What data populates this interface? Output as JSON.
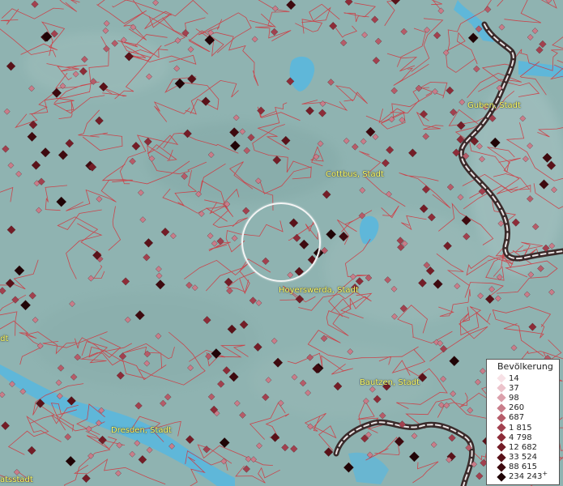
{
  "map": {
    "colors": {
      "terrain": "#8fb3b1",
      "water": "#5fb7d9",
      "borders": "#d3333b",
      "national_border": "#3a2a2a"
    }
  },
  "cities": [
    {
      "name": "Guben, Stadt"
    },
    {
      "name": "Cottbus, Stadt"
    },
    {
      "name": "Hoyerswerda, Stadt"
    },
    {
      "name": "Bautzen, Stadt"
    },
    {
      "name": "Dresden, Stadt"
    },
    {
      "name": "atsstadt"
    },
    {
      "name": "adt"
    }
  ],
  "legend": {
    "title": "Bevölkerung",
    "items": [
      {
        "label": "14",
        "color": "#f7e1e6"
      },
      {
        "label": "37",
        "color": "#ecc3cb"
      },
      {
        "label": "98",
        "color": "#dba0ab"
      },
      {
        "label": "260",
        "color": "#c97d8a"
      },
      {
        "label": "687",
        "color": "#b65c69"
      },
      {
        "label": "1 815",
        "color": "#a2414f"
      },
      {
        "label": "4 798",
        "color": "#8d2c38"
      },
      {
        "label": "12 682",
        "color": "#741d27"
      },
      {
        "label": "33 524",
        "color": "#5a1219"
      },
      {
        "label": "88 615",
        "color": "#3e0a0f"
      },
      {
        "label": "234 243",
        "color": "#200406",
        "more": "+"
      }
    ]
  }
}
